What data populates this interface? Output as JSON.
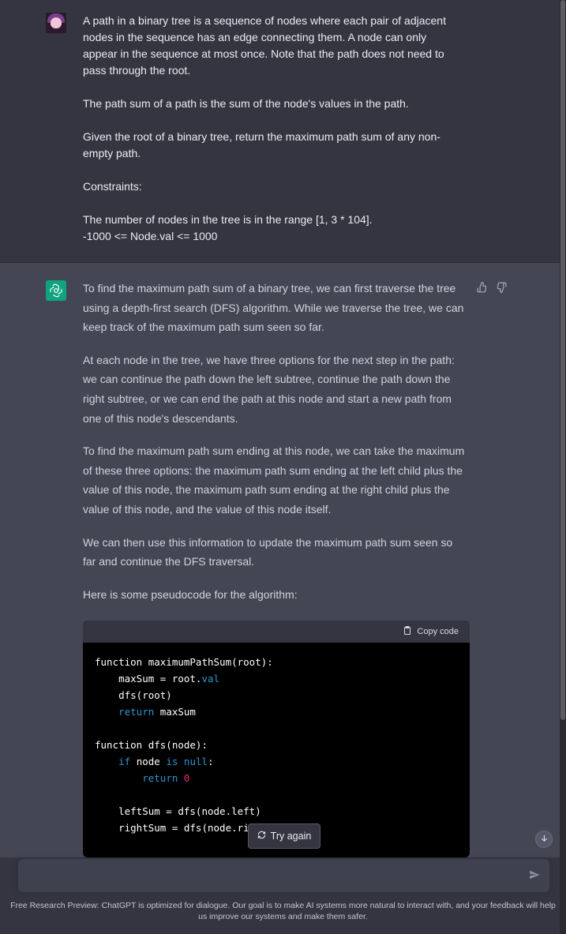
{
  "user_message": {
    "paragraphs": [
      "A path in a binary tree is a sequence of nodes where each pair of adjacent nodes in the sequence has an edge connecting them. A node can only appear in the sequence at most once. Note that the path does not need to pass through the root.",
      "The path sum of a path is the sum of the node's values in the path.",
      "Given the root of a binary tree, return the maximum path sum of any non-empty path.",
      "Constraints:"
    ],
    "constraints": [
      "The number of nodes in the tree is in the range [1, 3 * 104].",
      "-1000 <= Node.val <= 1000"
    ]
  },
  "assistant_message": {
    "paragraphs": [
      "To find the maximum path sum of a binary tree, we can first traverse the tree using a depth-first search (DFS) algorithm. While we traverse the tree, we can keep track of the maximum path sum seen so far.",
      "At each node in the tree, we have three options for the next step in the path: we can continue the path down the left subtree, continue the path down the right subtree, or we can end the path at this node and start a new path from one of this node's descendants.",
      "To find the maximum path sum ending at this node, we can take the maximum of these three options: the maximum path sum ending at the left child plus the value of this node, the maximum path sum ending at the right child plus the value of this node, and the value of this node itself.",
      "We can then use this information to update the maximum path sum seen so far and continue the DFS traversal.",
      "Here is some pseudocode for the algorithm:"
    ],
    "code": {
      "copy_label": "Copy code",
      "lines": {
        "l1": "function maximumPathSum(root):",
        "l2a": "    maxSum = root.",
        "l2b": "val",
        "l3": "    dfs(root)",
        "l4a": "    ",
        "l4b": "return",
        "l4c": " maxSum",
        "l6": "function dfs(node):",
        "l7a": "    ",
        "l7b": "if",
        "l7c": " node ",
        "l7d": "is",
        "l7e": " ",
        "l7f": "null",
        "l7g": ":",
        "l8a": "        ",
        "l8b": "return",
        "l8c": " ",
        "l8d": "0",
        "l10": "    leftSum = dfs(node.left)",
        "l11": "    rightSum = dfs(node.ri"
      }
    }
  },
  "controls": {
    "try_again_label": "Try again",
    "input_placeholder": "",
    "footer": "Free Research Preview: ChatGPT is optimized for dialogue. Our goal is to make AI systems more natural to interact with, and your feedback will help us improve our systems and make them safer."
  },
  "colors": {
    "background": "#343541",
    "assistant_background": "#444654",
    "accent": "#10a37f",
    "keyword": "#2e95d3",
    "number": "#df3079"
  },
  "icons": [
    "user-avatar",
    "chatgpt-logo-icon",
    "thumbs-up-icon",
    "thumbs-down-icon",
    "clipboard-icon",
    "refresh-icon",
    "arrow-down-icon",
    "send-icon"
  ]
}
